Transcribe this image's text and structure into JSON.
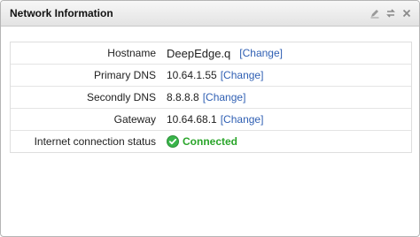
{
  "panel": {
    "title": "Network Information",
    "tools": [
      "edit-icon",
      "refresh-icon",
      "close-icon"
    ]
  },
  "rows": [
    {
      "label": "Hostname",
      "value": "DeepEdge.q",
      "link": "[Change]"
    },
    {
      "label": "Primary DNS",
      "value": "10.64.1.55",
      "link": "[Change]"
    },
    {
      "label": "Secondly DNS",
      "value": "8.8.8.8",
      "link": "[Change]"
    },
    {
      "label": "Gateway",
      "value": "10.64.68.1",
      "link": "[Change]"
    },
    {
      "label": "Internet connection status",
      "status": "Connected",
      "status_icon": "check-circle-icon"
    }
  ],
  "colors": {
    "link": "#2f5fb3",
    "connected": "#2aa52a"
  }
}
